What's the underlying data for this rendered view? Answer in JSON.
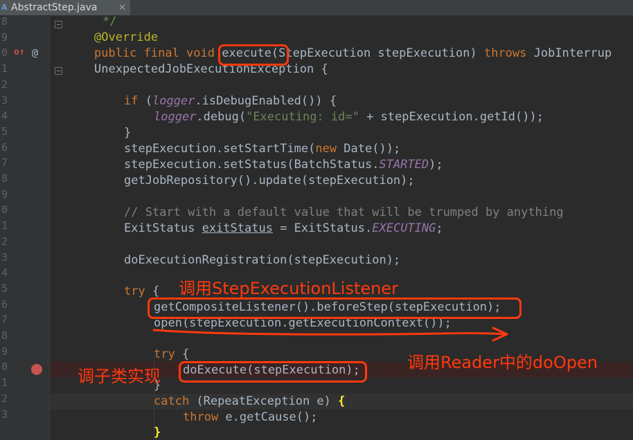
{
  "tab": {
    "file_name": "AbstractStep.java",
    "close_glyph": "✕"
  },
  "gutter": {
    "line_numbers": [
      "8",
      "9",
      "0",
      "1",
      "2",
      "3",
      "4",
      "5",
      "6",
      "7",
      "8",
      "9",
      "0",
      "1",
      "2",
      "3",
      "4",
      "5",
      "6",
      "7",
      "8",
      "9",
      "0",
      "1",
      "2",
      "3"
    ],
    "at_glyph": "@"
  },
  "code": {
    "l0_doc": "*/",
    "l1_annotation": "@Override",
    "l2_kw": "public final void",
    "l2_method": "execute",
    "l2_rest": "(StepExecution stepExecution)",
    "l2_throws": "throws",
    "l2_tail": "JobInterrup",
    "l3": "UnexpectedJobExecutionException {",
    "l5_if": "if",
    "l5_a": " (",
    "l5_logger": "logger",
    "l5_b": ".isDebugEnabled()) {",
    "l6_logger": "logger",
    "l6_a": ".debug(",
    "l6_str": "\"Executing: id=\"",
    "l6_b": " + stepExecution.getId());",
    "l7": "}",
    "l8_a": "stepExecution.setStartTime(",
    "l8_new": "new",
    "l8_b": " Date());",
    "l9_a": "stepExecution.setStatus(BatchStatus.",
    "l9_const": "STARTED",
    "l9_b": ");",
    "l10": "getJobRepository().update(stepExecution);",
    "l12_comment": "// Start with a default value that will be trumped by anything",
    "l13_a": "ExitStatus ",
    "l13_var": "exitStatus",
    "l13_b": " = ExitStatus.",
    "l13_const": "EXECUTING",
    "l13_c": ";",
    "l15": "doExecutionRegistration(stepExecution);",
    "l17_try": "try",
    "l17_b": " {",
    "l18": "getCompositeListener().beforeStep(stepExecution);",
    "l19": "open(stepExecution.getExecutionContext());",
    "l21_try": "try",
    "l21_b": " {",
    "l22": "doExecute(stepExecution);",
    "l23": "}",
    "l24_catch": "catch",
    "l24_a": " (RepeatException e) ",
    "l24_brace": "{",
    "l25_throw": "throw",
    "l25_a": " e.getCause();",
    "l26_brace": "}"
  },
  "annotations": {
    "listener_note": "调用StepExecutionListener",
    "reader_note": "调用Reader中的doOpen",
    "subclass_note": "调子类实现"
  },
  "colors": {
    "annotation_red": "#ff3a0e",
    "breakpoint": "#c75450"
  }
}
